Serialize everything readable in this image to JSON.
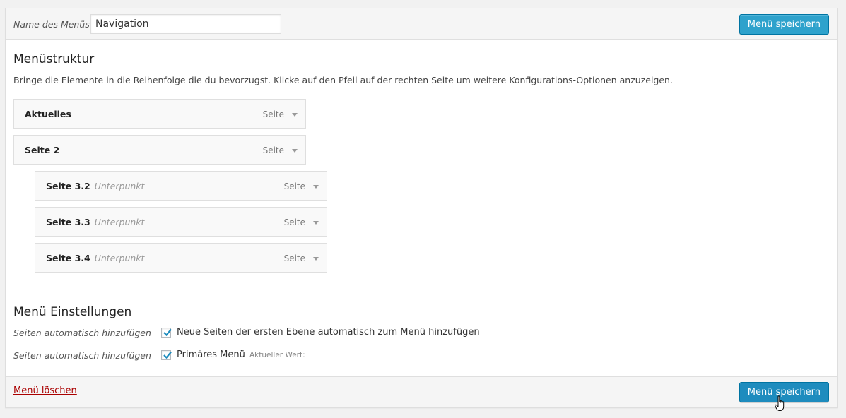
{
  "header": {
    "name_label": "Name des Menüs",
    "name_value": "Navigation",
    "save_label": "Menü speichern"
  },
  "structure": {
    "title": "Menüstruktur",
    "instructions": "Bringe die Elemente in die Reihenfolge die du bevorzugst. Klicke auf den Pfeil auf der rechten Seite um weitere Konfigurations-Optionen anzuzeigen.",
    "items": [
      {
        "title": "Aktuelles",
        "sub": "",
        "type": "Seite",
        "depth": 0
      },
      {
        "title": "Seite 2",
        "sub": "",
        "type": "Seite",
        "depth": 0
      },
      {
        "title": "Seite 3.2",
        "sub": "Unterpunkt",
        "type": "Seite",
        "depth": 1
      },
      {
        "title": "Seite 3.3",
        "sub": "Unterpunkt",
        "type": "Seite",
        "depth": 1
      },
      {
        "title": "Seite 3.4",
        "sub": "Unterpunkt",
        "type": "Seite",
        "depth": 1
      }
    ]
  },
  "settings": {
    "title": "Menü Einstellungen",
    "rows": [
      {
        "label": "Seiten automatisch hinzufügen",
        "checked": true,
        "text": "Neue Seiten der ersten Ebene automatisch zum Menü hinzufügen",
        "note": ""
      },
      {
        "label": "Seiten automatisch hinzufügen",
        "checked": true,
        "text": "Primäres Menü",
        "note": "Aktueller Wert:"
      }
    ]
  },
  "footer": {
    "delete_label": "Menü löschen",
    "save_label": "Menü speichern"
  },
  "icons": {
    "item_toggle": "triangle-down-icon",
    "checkbox_mark": "checkmark-icon",
    "cursor": "hand-pointer-icon"
  },
  "colors": {
    "primary_button": "#2ea2cc",
    "delete_link": "#aa0000",
    "checkmark": "#1e8cbe"
  }
}
